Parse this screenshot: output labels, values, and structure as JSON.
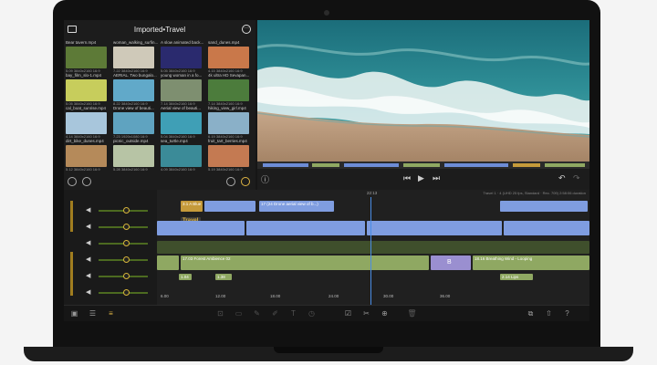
{
  "browser": {
    "title": "Imported•Travel",
    "clips": [
      {
        "name": "Bear tavern.mp4",
        "meta": "5.09 3840x2160 16:9",
        "color": "#5d7a37"
      },
      {
        "name": "woman_walking_surfin...",
        "meta": "7.22 3840x2160 16:9",
        "color": "#cfc9b9"
      },
      {
        "name": "A slow animated back...",
        "meta": "5.05 3840x2160 16:9",
        "color": "#2a2a6e"
      },
      {
        "name": "sand_dunes.mp4",
        "meta": "4.15 3840x2160 16:9",
        "color": "#c9784a"
      },
      {
        "name": "bay_film_slo-1.mp4",
        "meta": "5.05 3840x2160 16:9",
        "color": "#c7cd5c"
      },
      {
        "name": "AERIAL. Two bungalo...",
        "meta": "8.22 3840x2160 16:9",
        "color": "#61a9c9"
      },
      {
        "name": "young woman in a fo...",
        "meta": "7.14 3840x2160 16:9",
        "color": "#7e8f70"
      },
      {
        "name": "4k ultra HD Sevapan...",
        "meta": "7.14 3840x2160 16:9",
        "color": "#4c7c3c"
      },
      {
        "name": "cal_boat_sunrise.mp4",
        "meta": "4.14 3840x2160 16:9",
        "color": "#a8c6dc"
      },
      {
        "name": "Drone view of beauti...",
        "meta": "7.23 1920x1080 16:9",
        "color": "#5fa3c0"
      },
      {
        "name": "Aerial view of beauti...",
        "meta": "5.04 3840x2160 16:9",
        "color": "#3f9fb6"
      },
      {
        "name": "hiking_view_girl.mp4",
        "meta": "6.19 3840x2160 16:9",
        "color": "#8ab0c8"
      },
      {
        "name": "dirt_bike_dunes.mp4",
        "meta": "5.12 3840x2160 16:9",
        "color": "#b58a5a"
      },
      {
        "name": "picnic_outside.mp4",
        "meta": "5.28 3840x2160 16:9",
        "color": "#b7c4a5"
      },
      {
        "name": "sea_turtle.mp4",
        "meta": "4.09 3840x2160 16:9",
        "color": "#3b8b98"
      },
      {
        "name": "fruit_tart_berries.mp4",
        "meta": "5.19 3840x2160 16:9",
        "color": "#c47a52"
      }
    ]
  },
  "timeline": {
    "info": "Travel 1 · 4 (UHD 25 fps, Standard · Rec. 709) 2:58:06 duration",
    "playhead_time": "22:13",
    "title_overlay": "Travel",
    "audio_clips": {
      "forest": "17.03 Forest Ambience 02",
      "wind": "18.16 Breathing Wind - Looping",
      "b_label": "B",
      "marker1": "1.04",
      "marker2": "1.38",
      "marker3": "2.14 Lips"
    },
    "ruler": [
      "6.00",
      "12.00",
      "18.00",
      "24.00",
      "30.00",
      "36.00"
    ],
    "clip_labels": [
      "3.1 A Blue",
      "17 (24 Drone aerial view of b...)"
    ]
  },
  "colors": {
    "accent": "#e0b543",
    "video_track": "#7f9de0",
    "audio_track": "#8fa862",
    "playhead": "#4a8de6"
  }
}
